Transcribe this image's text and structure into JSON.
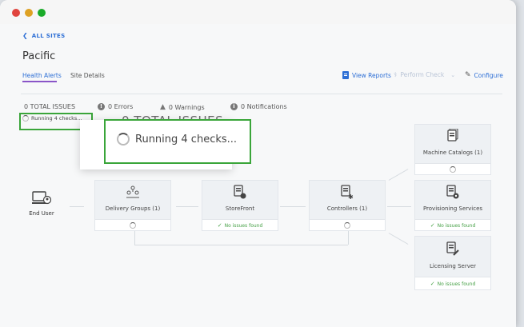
{
  "window": {
    "dots": [
      "#e0443e",
      "#dea123",
      "#1aab29"
    ]
  },
  "nav": {
    "back_label": "ALL SITES"
  },
  "site": {
    "title": "Pacific"
  },
  "tabs": [
    {
      "label": "Health Alerts"
    },
    {
      "label": "Site Details"
    }
  ],
  "actions": {
    "view_reports": "View Reports",
    "perform_check": "Perform Check",
    "configure": "Configure"
  },
  "summary": {
    "total": "0 TOTAL ISSUES",
    "errors": "0 Errors",
    "warnings": "0 Warnings",
    "notifications": "0 Notifications",
    "running": "Running 4 checks..."
  },
  "zoom": {
    "total": "0 TOTAL ISSUES",
    "running": "Running 4 checks..."
  },
  "end_user": {
    "label": "End User"
  },
  "components": {
    "delivery_groups": {
      "label": "Delivery Groups (1)"
    },
    "storefront": {
      "label": "StoreFront",
      "status": "No issues found"
    },
    "controllers": {
      "label": "Controllers (1)"
    },
    "machine_catalogs": {
      "label": "Machine Catalogs (1)"
    },
    "provisioning_services": {
      "label": "Provisioning Services",
      "status": "No issues found"
    },
    "licensing_server": {
      "label": "Licensing Server",
      "status": "No issues found"
    }
  },
  "colors": {
    "accent": "#2c6ed5",
    "ok": "#46a046",
    "highlight": "#3aa53a",
    "tab_underline": "#8a55c8"
  }
}
